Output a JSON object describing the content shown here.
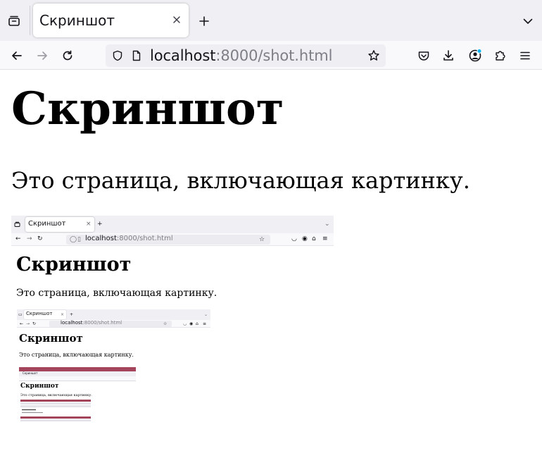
{
  "browser": {
    "tab": {
      "title": "Скриншот"
    },
    "urlbar": {
      "host": "localhost",
      "rest": ":8000/shot.html"
    },
    "icons": {
      "tab_list": "tab-list-icon",
      "tab_close": "close-icon",
      "new_tab": "plus-icon",
      "tab_overflow": "chevron-down-icon",
      "back": "back-arrow-icon",
      "forward": "forward-arrow-icon",
      "reload": "reload-icon",
      "tracking": "shield-icon",
      "page_info": "page-icon",
      "bookmark": "star-icon",
      "pocket": "pocket-icon",
      "downloads": "download-icon",
      "account": "account-icon",
      "extensions": "puzzle-icon",
      "menu": "hamburger-menu-icon"
    },
    "colors": {
      "accent_dot": "#00b3f4"
    }
  },
  "page": {
    "title": "Скриншот",
    "text": "Это страница, включающая картинку."
  },
  "embedded": {
    "level1": {
      "tab_title": "Скриншот",
      "url_host": "localhost",
      "url_rest": ":8000/shot.html",
      "title": "Скриншот",
      "text": "Это страница, включающая картинку."
    },
    "level2": {
      "tab_title": "Скриншот",
      "url_host": "localhost",
      "url_rest": ":8000/shot.html",
      "title": "Скриншот",
      "text": "Это страница, включающая картинку."
    },
    "level3": {
      "tab_title": "Скриншот",
      "title": "Скриншот",
      "text": "Это страница, включающая картинку."
    },
    "colors": {
      "titlebar": "#a3445a"
    }
  }
}
